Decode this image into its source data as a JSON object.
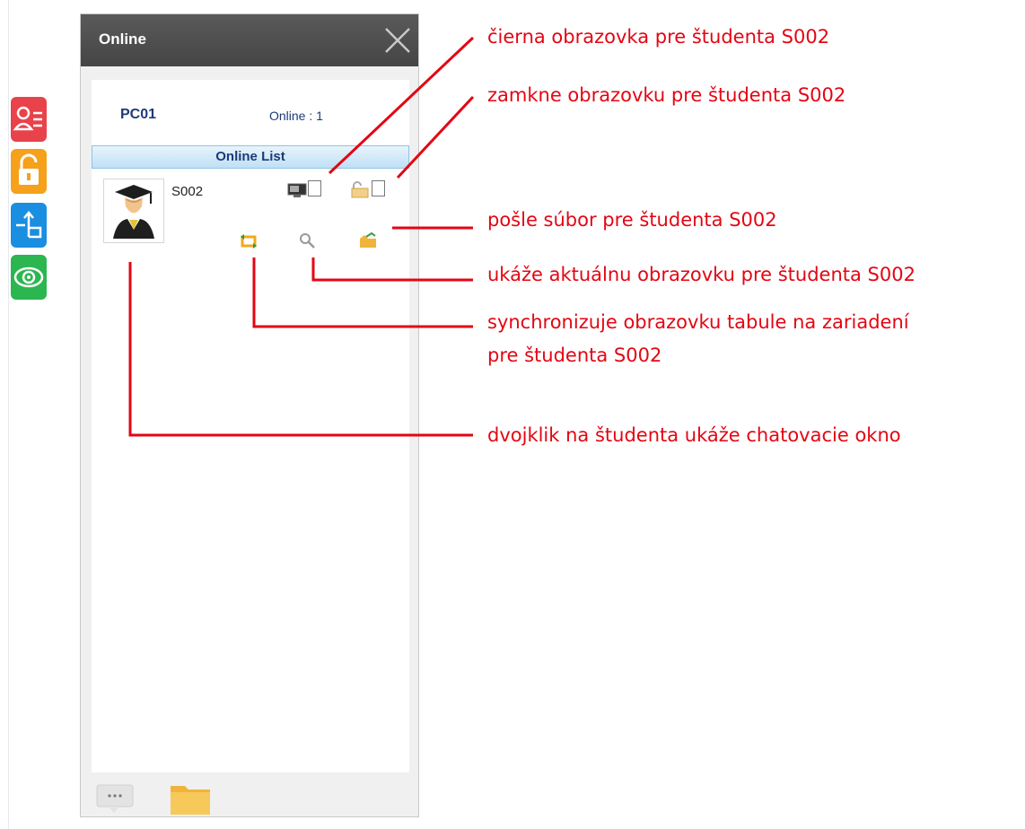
{
  "window": {
    "title": "Online",
    "pc_name": "PC01",
    "online_count": "Online : 1",
    "list_header": "Online List"
  },
  "student": {
    "id": "S002"
  },
  "side_toolbar": {
    "buttons": [
      {
        "name": "attendance",
        "color": "#e8424a"
      },
      {
        "name": "unlock",
        "color": "#f5a11b"
      },
      {
        "name": "share",
        "color": "#1a8ee0"
      },
      {
        "name": "monitor",
        "color": "#2bb650"
      }
    ]
  },
  "annotations": {
    "black_screen": "čierna obrazovka pre študenta S002",
    "lock_screen": "zamkne obrazovku pre študenta S002",
    "send_file": "pošle súbor pre študenta S002",
    "show_screen": "ukáže aktuálnu obrazovku pre študenta S002",
    "sync_line1": "synchronizuje obrazovku tabule na zariadení",
    "sync_line2": "pre študenta S002",
    "chat": "dvojklik na študenta ukáže chatovacie okno"
  },
  "colors": {
    "annotation": "#e30613",
    "header": "#4a4a4a",
    "list_header": "#bfe0f6"
  }
}
